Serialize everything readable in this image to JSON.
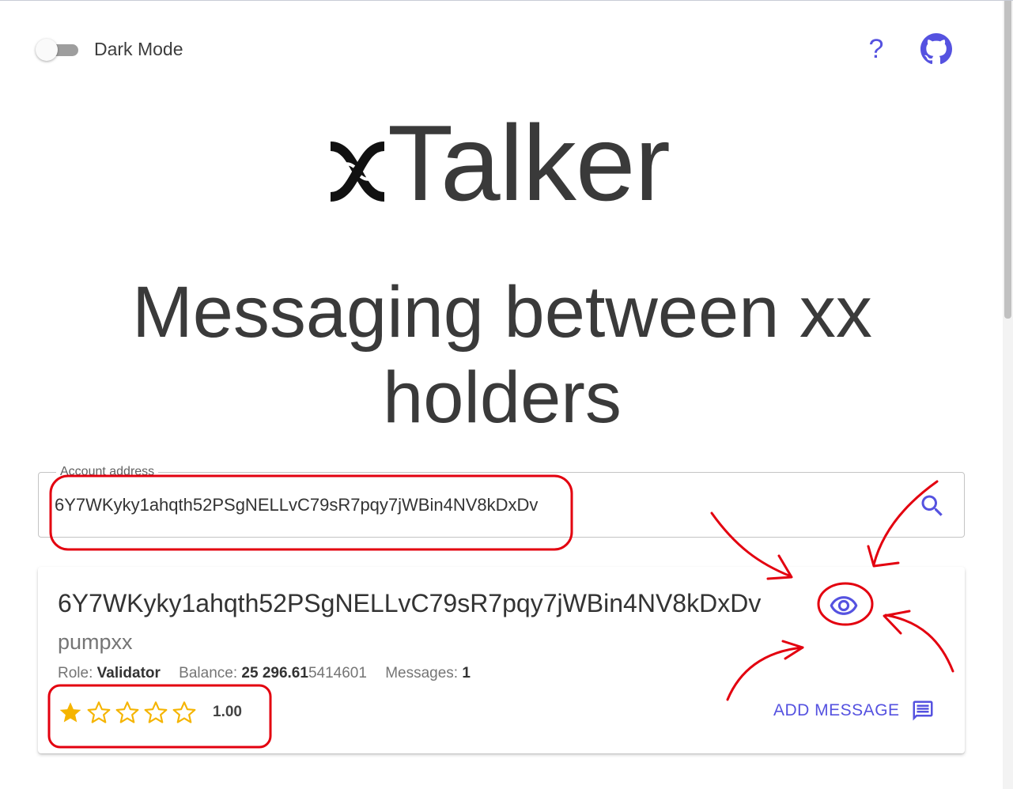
{
  "theme": {
    "accent": "#5552e0",
    "star": "#f5b400",
    "annotation": "#e3000f"
  },
  "header": {
    "dark_mode_label": "Dark Mode",
    "dark_mode_enabled": false,
    "help_label": "?",
    "help_icon": "question-mark-icon",
    "github_icon": "github-icon"
  },
  "brand": {
    "logo_icon": "xx-network-logo-icon",
    "title": "Talker"
  },
  "hero": {
    "title": "Messaging between xx holders"
  },
  "search": {
    "label": "Account address",
    "value": "6Y7WKyky1ahqth52PSgNELLvC79sR7pqy7jWBin4NV8kDxDv",
    "search_icon": "search-icon"
  },
  "account": {
    "address": "6Y7WKyky1ahqth52PSgNELLvC79sR7pqy7jWBin4NV8kDxDv",
    "name": "pumpxx",
    "role_label": "Role:",
    "role": "Validator",
    "balance_label": "Balance:",
    "balance_main": "25 296.61",
    "balance_rest": "5414601",
    "messages_label": "Messages:",
    "messages": "1",
    "rating": 1,
    "rating_max": 5,
    "rating_value": "1.00",
    "view_icon": "eye-icon",
    "add_message_label": "ADD MESSAGE",
    "add_message_icon": "message-icon"
  }
}
